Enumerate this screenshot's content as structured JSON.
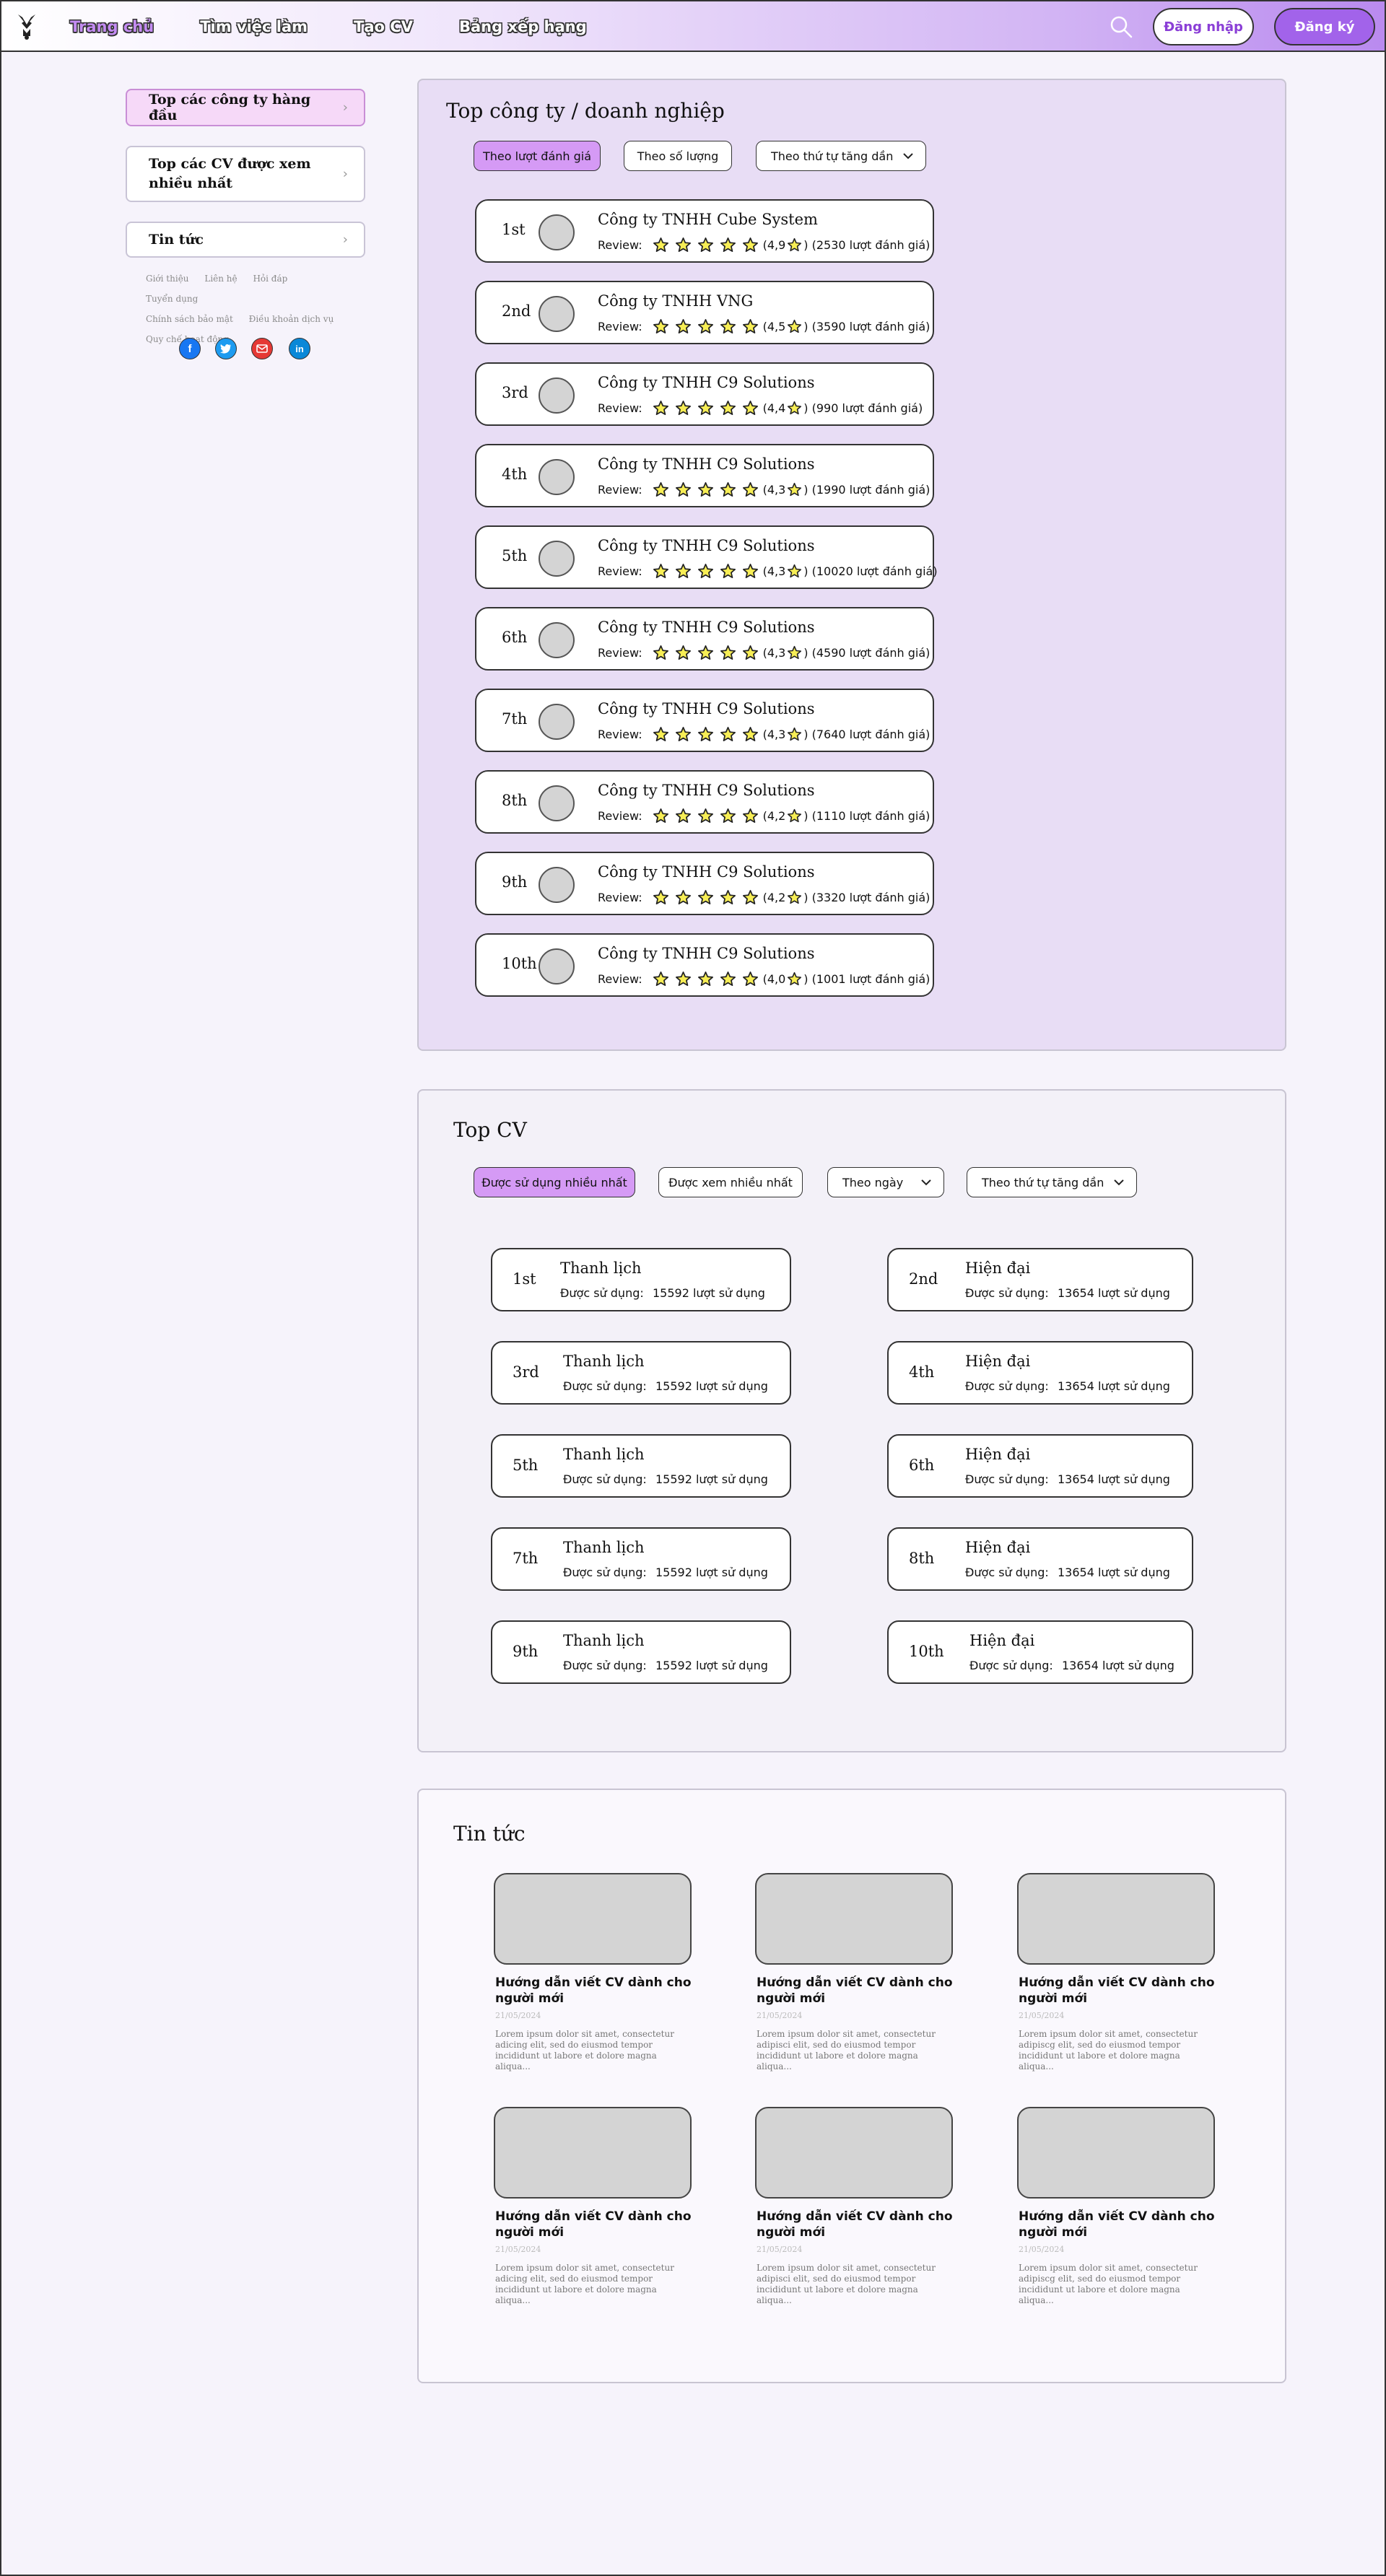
{
  "header": {
    "nav": [
      "Trang chủ",
      "Tìm việc làm",
      "Tạo CV",
      "Bảng xếp hạng"
    ],
    "login": "Đăng nhập",
    "register": "Đăng ký"
  },
  "sidebar": {
    "items": [
      "Top các công ty hàng đầu",
      "Top các CV được xem nhiều nhất",
      "Tin tức"
    ],
    "links_row1": [
      "Giới thiệu",
      "Liên hệ",
      "Hỏi đáp",
      "Tuyển dụng"
    ],
    "links_row2": [
      "Chính sách bảo mật",
      "Điều khoản dịch vụ"
    ],
    "links_row3": [
      "Quy chế hoạt động"
    ],
    "social": [
      "facebook-icon",
      "twitter-icon",
      "mail-icon",
      "linkedin-icon"
    ]
  },
  "companies": {
    "title": "Top công ty / doanh nghiệp",
    "filters": [
      "Theo lượt đánh giá",
      "Theo số lượng",
      "Theo thứ tự tăng dần"
    ],
    "review_label": "Review:",
    "list": [
      {
        "rank": "1st",
        "name": "Công ty TNHH Cube System",
        "score_pre": "(4,9",
        "count": ") (2530 lượt đánh giá)"
      },
      {
        "rank": "2nd",
        "name": "Công ty TNHH VNG",
        "score_pre": "(4,5",
        "count": ") (3590 lượt đánh giá)"
      },
      {
        "rank": "3rd",
        "name": "Công ty TNHH C9 Solutions",
        "score_pre": "(4,4",
        "count": ") (990 lượt đánh giá)"
      },
      {
        "rank": "4th",
        "name": "Công ty TNHH C9 Solutions",
        "score_pre": "(4,3",
        "count": ") (1990 lượt đánh giá)"
      },
      {
        "rank": "5th",
        "name": "Công ty TNHH C9 Solutions",
        "score_pre": "(4,3",
        "count": ") (10020 lượt đánh giá)"
      },
      {
        "rank": "6th",
        "name": "Công ty TNHH C9 Solutions",
        "score_pre": "(4,3",
        "count": ") (4590 lượt đánh giá)"
      },
      {
        "rank": "7th",
        "name": "Công ty TNHH C9 Solutions",
        "score_pre": "(4,3",
        "count": ") (7640 lượt đánh giá)"
      },
      {
        "rank": "8th",
        "name": "Công ty TNHH C9 Solutions",
        "score_pre": "(4,2",
        "count": ") (1110 lượt đánh giá)"
      },
      {
        "rank": "9th",
        "name": "Công ty TNHH C9 Solutions",
        "score_pre": "(4,2",
        "count": ") (3320 lượt đánh giá)"
      },
      {
        "rank": "10th",
        "name": "Công ty TNHH C9 Solutions",
        "score_pre": "(4,0",
        "count": ") (1001 lượt đánh giá)"
      }
    ]
  },
  "cv": {
    "title": "Top CV",
    "filters": [
      "Được sử dụng nhiều nhất",
      "Được xem nhiều nhất",
      "Theo ngày",
      "Theo thứ tự tăng dần"
    ],
    "usage_label": "Được sử dụng:",
    "list": [
      {
        "rank": "1st",
        "name": "Thanh lịch",
        "count": "15592 lượt sử dụng"
      },
      {
        "rank": "2nd",
        "name": "Hiện đại",
        "count": "13654 lượt sử dụng"
      },
      {
        "rank": "3rd",
        "name": "Thanh lịch",
        "count": "15592 lượt sử dụng"
      },
      {
        "rank": "4th",
        "name": "Hiện đại",
        "count": "13654 lượt sử dụng"
      },
      {
        "rank": "5th",
        "name": "Thanh lịch",
        "count": "15592 lượt sử dụng"
      },
      {
        "rank": "6th",
        "name": "Hiện đại",
        "count": "13654 lượt sử dụng"
      },
      {
        "rank": "7th",
        "name": "Thanh lịch",
        "count": "15592 lượt sử dụng"
      },
      {
        "rank": "8th",
        "name": "Hiện đại",
        "count": "13654 lượt sử dụng"
      },
      {
        "rank": "9th",
        "name": "Thanh lịch",
        "count": "15592 lượt sử dụng"
      },
      {
        "rank": "10th",
        "name": "Hiện đại",
        "count": "13654 lượt sử dụng"
      }
    ]
  },
  "news": {
    "title": "Tin tức",
    "items": [
      {
        "title": "Hướng dẫn viết CV dành cho người mới",
        "date": "21/05/2024",
        "excerpt": "Lorem ipsum dolor sit amet, consectetur adicing elit, sed do eiusmod tempor incididunt ut labore et dolore magna aliqua..."
      },
      {
        "title": "Hướng dẫn viết CV dành cho người mới",
        "date": "21/05/2024",
        "excerpt": "Lorem ipsum dolor sit amet, consectetur adipisci elit, sed do eiusmod tempor incididunt ut labore et dolore magna aliqua..."
      },
      {
        "title": "Hướng dẫn viết CV dành cho người mới",
        "date": "21/05/2024",
        "excerpt": "Lorem ipsum dolor sit amet, consectetur adipiscg elit, sed do eiusmod tempor incididunt ut labore et dolore magna aliqua..."
      },
      {
        "title": "Hướng dẫn viết CV dành cho người mới",
        "date": "21/05/2024",
        "excerpt": "Lorem ipsum dolor sit amet, consectetur adicing elit, sed do eiusmod tempor incididunt ut labore et dolore magna aliqua..."
      },
      {
        "title": "Hướng dẫn viết CV dành cho người mới",
        "date": "21/05/2024",
        "excerpt": "Lorem ipsum dolor sit amet, consectetur adipisci elit, sed do eiusmod tempor incididunt ut labore et dolore magna aliqua..."
      },
      {
        "title": "Hướng dẫn viết CV dành cho người mới",
        "date": "21/05/2024",
        "excerpt": "Lorem ipsum dolor sit amet, consectetur adipiscg elit, sed do eiusmod tempor incididunt ut labore et dolore magna aliqua..."
      }
    ]
  },
  "colors": {
    "accent": "#a263ea",
    "active_pill": "#d59af5",
    "panel_bg": "#e8ddf5",
    "star_fill": "#f7ee55"
  }
}
